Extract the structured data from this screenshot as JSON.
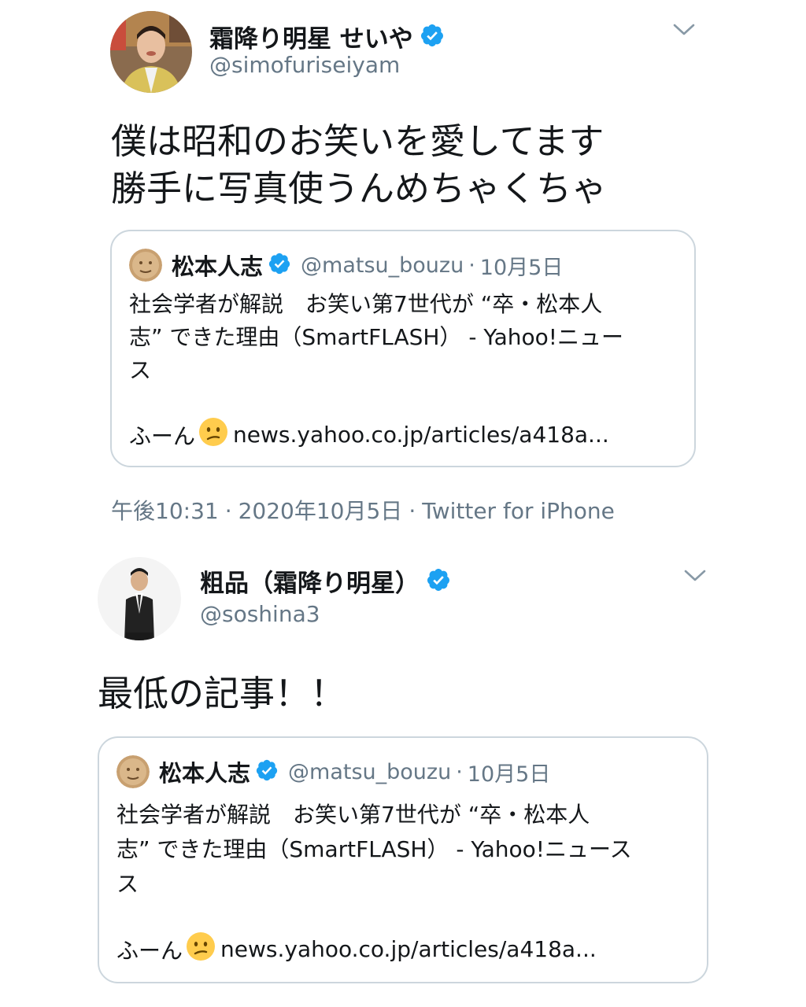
{
  "tweet1": {
    "display_name": "霜降り明星 せいや",
    "handle": "@simofuriseiyam",
    "text_lines": [
      "僕は昭和のお笑いを愛してます",
      "勝手に写真使うんめちゃくちゃ"
    ],
    "quote": {
      "name": "松本人志",
      "handle": "@matsu_bouzu",
      "separator": "·",
      "date": "10月5日",
      "text_lines": [
        "社会学者が解説　お笑い第7世代が “卒・松本人",
        "志” できた理由（SmartFLASH） - Yahoo!ニュー",
        "ス"
      ],
      "link_prefix": "ふーん",
      "link": "news.yahoo.co.jp/articles/a418a..."
    },
    "meta": {
      "time": "午後10:31",
      "date": "2020年10月5日",
      "source": "Twitter for iPhone",
      "separator": "·"
    }
  },
  "tweet2": {
    "display_name": "粗品（霜降り明星）",
    "handle": "@soshina3",
    "text": "最低の記事！！",
    "quote": {
      "name": "松本人志",
      "handle": "@matsu_bouzu",
      "separator": "·",
      "date": "10月5日",
      "text_lines": [
        "社会学者が解説　お笑い第7世代が “卒・松本人",
        "志” できた理由（SmartFLASH） - Yahoo!ニュース",
        "ス"
      ],
      "link_prefix": "ふーん",
      "link": "news.yahoo.co.jp/articles/a418a..."
    }
  },
  "colors": {
    "text": "#14171a",
    "secondary": "#657786",
    "verified": "#1da1f2",
    "border": "#ccd6dd",
    "emoji": "#ffcc4d"
  },
  "icons": [
    "verified-badge-icon",
    "chevron-down-icon",
    "confused-face-emoji-icon"
  ]
}
